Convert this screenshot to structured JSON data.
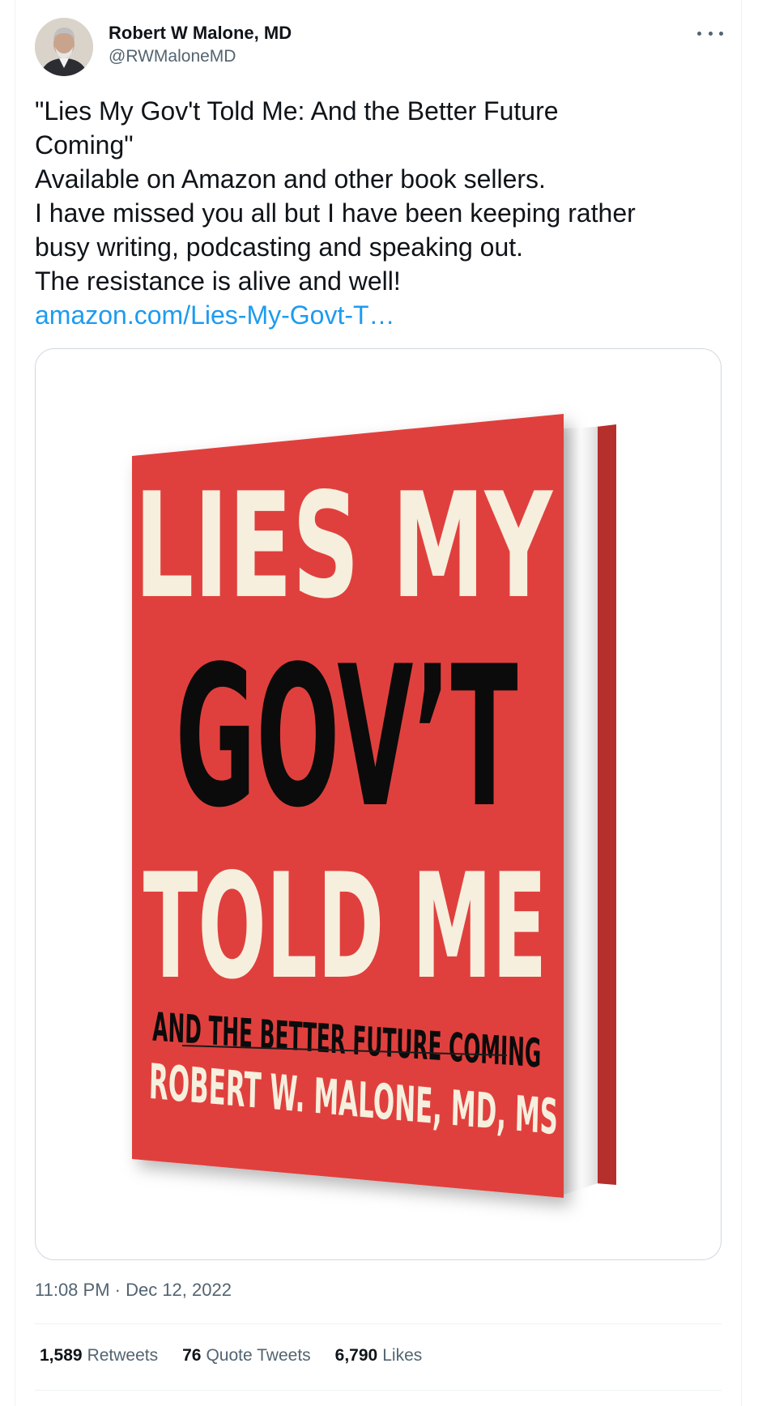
{
  "author": {
    "display_name": "Robert W Malone, MD",
    "handle": "@RWMaloneMD"
  },
  "tweet": {
    "lines": [
      "\"Lies My Gov't Told Me: And the Better Future",
      "Coming\"",
      "Available on Amazon and other book sellers.",
      "I have missed you all but I have been keeping rather",
      "busy writing, podcasting and speaking out.",
      "The resistance is alive and well!"
    ],
    "link": "amazon.com/Lies-My-Govt-T…",
    "timestamp": "11:08 PM · Dec 12, 2022"
  },
  "book_cover": {
    "title_line1": "LIES MY",
    "title_line2": "GOV’T",
    "title_line3": "TOLD ME",
    "subtitle": "AND THE BETTER FUTURE COMING",
    "author_line": "ROBERT W. MALONE, MD, MS",
    "cover_color": "#e0413e",
    "light_text_color": "#f7efde",
    "dark_text_color": "#0b0b0b"
  },
  "stats": {
    "retweets_count": "1,589",
    "retweets_label": "Retweets",
    "quotes_count": "76",
    "quotes_label": "Quote Tweets",
    "likes_count": "6,790",
    "likes_label": "Likes"
  },
  "colors": {
    "link": "#1d9bf0",
    "secondary_text": "#536471",
    "border": "#cfd9de"
  },
  "icons": {
    "more": "more-horizontal-icon"
  }
}
